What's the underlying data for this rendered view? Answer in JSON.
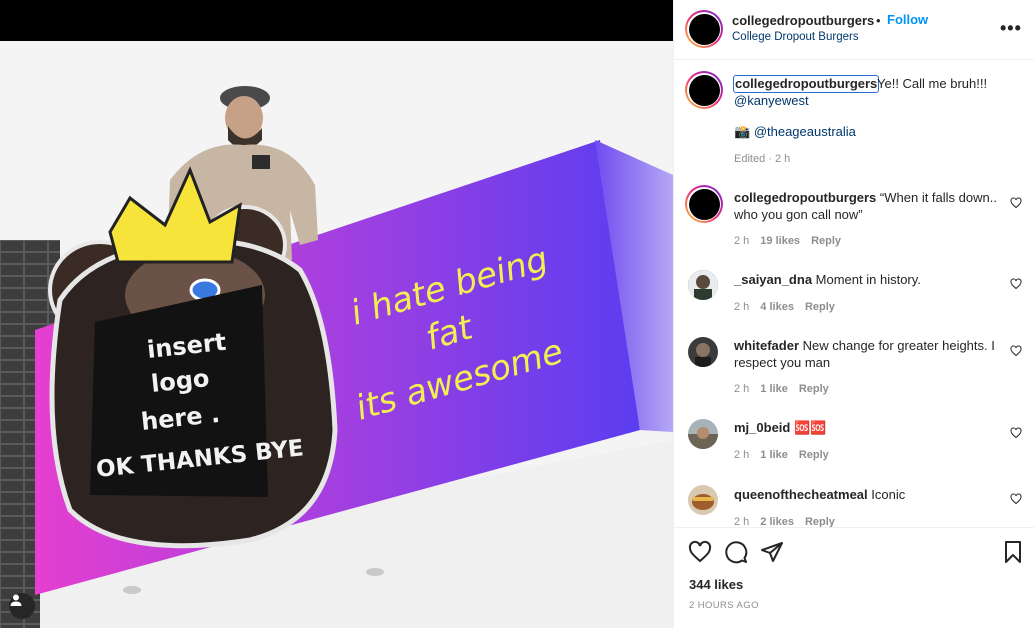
{
  "photo": {
    "badge_lines": [
      "insert",
      "logo",
      "here .",
      "OK THANKS BYE"
    ],
    "sign_lines": [
      "i hate being",
      "fat",
      "its awesome"
    ],
    "user_tag_icon": "person-icon"
  },
  "header": {
    "username": "collegedropoutburgers",
    "bullet": "•",
    "follow_label": "Follow",
    "subtitle": "College Dropout Burgers",
    "more_icon": "more-options-icon",
    "more_label": "•••"
  },
  "caption": {
    "username": "collegedropoutburgers",
    "text": "Ye!! Call me bruh!!!",
    "mention1": "@kanyewest",
    "mention2_emoji": "📸",
    "mention2": "@theageaustralia",
    "meta": "Edited · 2 h"
  },
  "comments": [
    {
      "username": "collegedropoutburgers",
      "text": "“When it falls down.. who you gon call now”",
      "time": "2 h",
      "likes": "19 likes",
      "reply": "Reply"
    },
    {
      "username": "_saiyan_dna",
      "text": "Moment in history.",
      "time": "2 h",
      "likes": "4 likes",
      "reply": "Reply"
    },
    {
      "username": "whitefader",
      "text": "New change for greater heights. I respect you man",
      "time": "2 h",
      "likes": "1 like",
      "reply": "Reply"
    },
    {
      "username": "mj_0beid",
      "text": "🆘🆘",
      "time": "2 h",
      "likes": "1 like",
      "reply": "Reply"
    },
    {
      "username": "queenofthecheatmeal",
      "text": "Iconic",
      "time": "2 h",
      "likes": "2 likes",
      "reply": "Reply"
    }
  ],
  "actions": {
    "like_icon": "heart-icon",
    "comment_icon": "comment-icon",
    "share_icon": "share-icon",
    "save_icon": "bookmark-icon",
    "likes": "344 likes",
    "posted": "2 HOURS AGO"
  },
  "colors": {
    "link": "#00376b",
    "follow": "#0095f6",
    "muted": "#8e8e8e",
    "sign_magenta": "#d83ad0",
    "sign_purple": "#6a3ee8"
  }
}
